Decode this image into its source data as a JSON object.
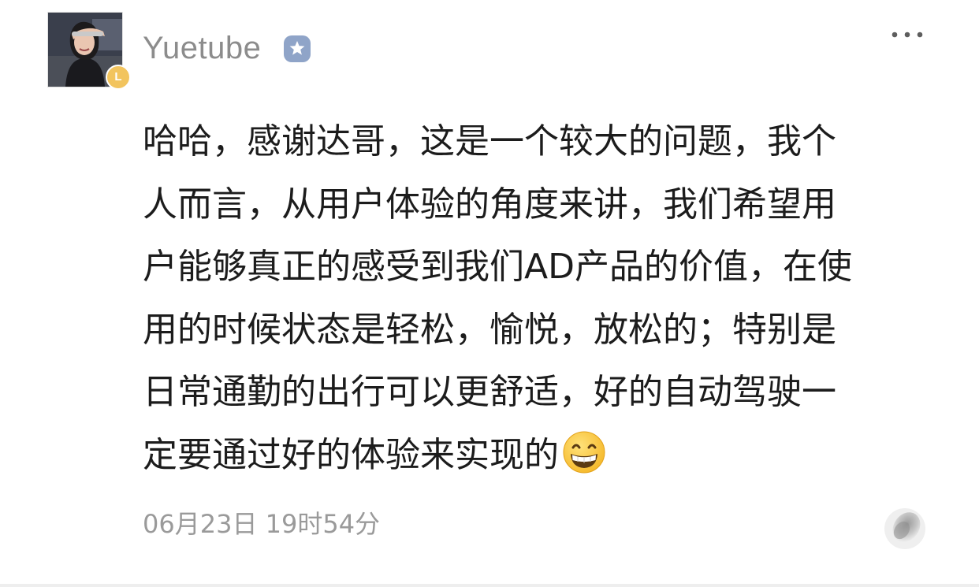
{
  "post": {
    "author": {
      "name": "Yuetube",
      "level_badge": "L",
      "verified_icon": "verified-star-icon",
      "avatar_icon": "profile-photo"
    },
    "content_lines": [
      "哈哈，感谢达哥，这是一个较大的问题，我个",
      "人而言，从用户体验的角度来讲，我们希望用",
      "户能够真正的感受到我们AD产品的价值，在使",
      "用的时候状态是轻松，愉悦，放松的；特别是",
      "日常通勤的出行可以更舒适，好的自动驾驶一",
      "定要通过好的体验来实现的"
    ],
    "trailing_emoji": "grinning-face-emoji",
    "timestamp": "06月23日 19时54分"
  },
  "actions": {
    "more_icon": "more-dots-icon",
    "like_icon": "like-icon"
  },
  "colors": {
    "username": "#8c8c8c",
    "text": "#1c1c1c",
    "timestamp": "#9a9a9a",
    "badge": "#f2c45e",
    "verified": "#8fa4c8"
  }
}
